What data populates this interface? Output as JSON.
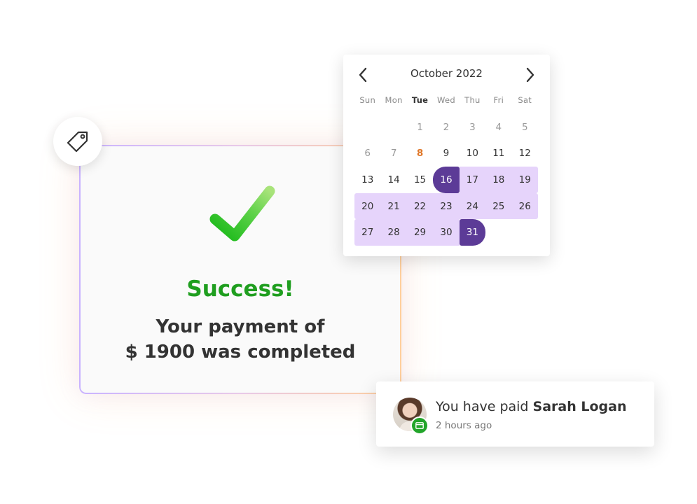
{
  "success_card": {
    "title": "Success!",
    "message_line1": "Your payment of",
    "message_line2": "$ 1900 was completed"
  },
  "calendar": {
    "month_label": "October 2022",
    "weekdays": [
      "Sun",
      "Mon",
      "Tue",
      "Wed",
      "Thu",
      "Fri",
      "Sat"
    ],
    "today_weekday_index": 2,
    "weeks": [
      [
        "",
        "",
        "1",
        "2",
        "3",
        "4",
        "5"
      ],
      [
        "6",
        "7",
        "8",
        "9",
        "10",
        "11",
        "12"
      ],
      [
        "13",
        "14",
        "15",
        "16",
        "17",
        "18",
        "19"
      ],
      [
        "20",
        "21",
        "22",
        "23",
        "24",
        "25",
        "26"
      ],
      [
        "27",
        "28",
        "29",
        "30",
        "31",
        "",
        ""
      ]
    ],
    "today": "8",
    "range_start": "16",
    "range_end": "31"
  },
  "notification": {
    "prefix": "You have paid ",
    "name": "Sarah Logan",
    "time": "2 hours ago"
  },
  "colors": {
    "success_green": "#1f9e1f",
    "range_fill": "#e6d4fb",
    "range_endpoint": "#5c3b97",
    "today_orange": "#e0782a",
    "badge_green": "#22a52a"
  },
  "icons": {
    "tag": "tag-icon",
    "check": "checkmark-icon",
    "prev": "chevron-left-icon",
    "next": "chevron-right-icon",
    "card": "credit-card-icon"
  }
}
